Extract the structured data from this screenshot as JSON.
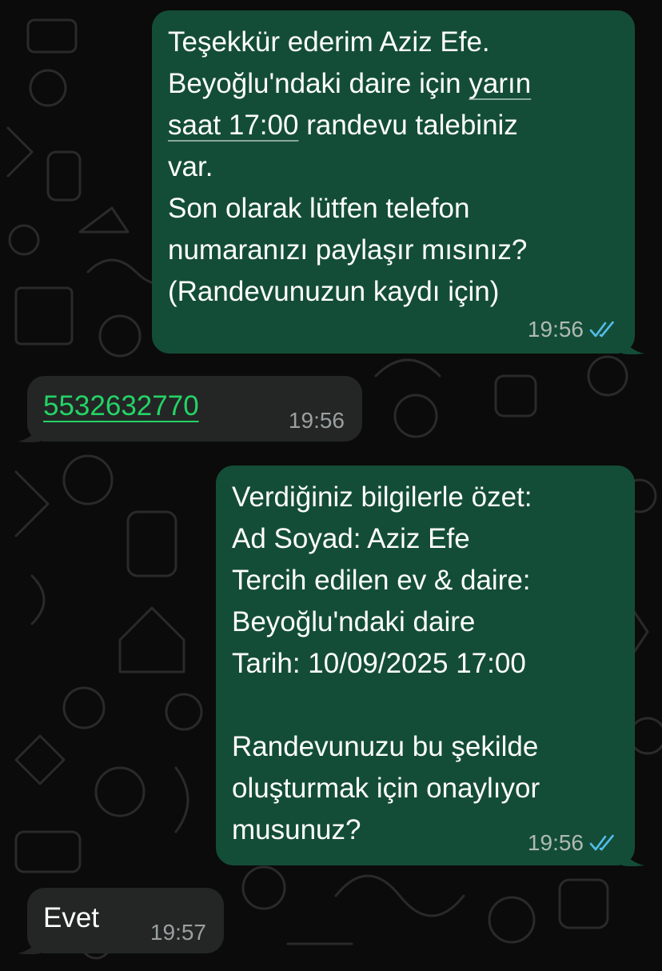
{
  "colors": {
    "outgoing_bubble": "#144d37",
    "incoming_bubble": "#242626",
    "link": "#25d366",
    "read_ticks": "#53bdeb",
    "background": "#0b0b0b"
  },
  "messages": [
    {
      "direction": "outgoing",
      "lines": [
        "Teşekkür ederim Aziz Efe.",
        "Beyoğlu'ndaki daire için ",
        "yarın",
        "saat 17:00",
        " randevu talebiniz",
        "var.",
        "Son olarak lütfen telefon",
        "numaranızı paylaşır mısınız?",
        "(Randevunuzun kaydı için)"
      ],
      "time": "19:56",
      "status_icon": "double-check-read-icon"
    },
    {
      "direction": "incoming",
      "phone": "5532632770",
      "time": "19:56"
    },
    {
      "direction": "outgoing",
      "lines": [
        "Verdiğiniz bilgilerle özet:",
        "Ad Soyad: Aziz Efe",
        "Tercih edilen ev & daire:",
        "Beyoğlu'ndaki daire",
        "Tarih: 10/09/2025 17:00",
        "",
        "Randevunuzu bu şekilde",
        "oluşturmak için onaylıyor",
        "musunuz?"
      ],
      "time": "19:56",
      "status_icon": "double-check-read-icon"
    },
    {
      "direction": "incoming",
      "text": "Evet",
      "time": "19:57"
    }
  ]
}
